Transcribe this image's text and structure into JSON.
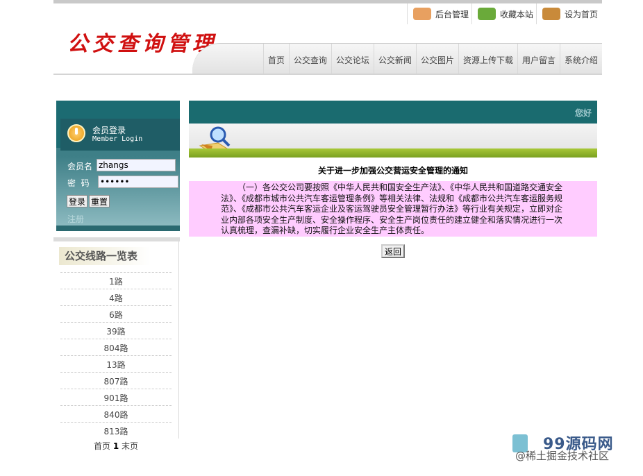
{
  "site": {
    "title": "公交查询管理"
  },
  "toplinks": [
    {
      "label": "后台管理",
      "icon": "admin-icon"
    },
    {
      "label": "收藏本站",
      "icon": "favorite-icon"
    },
    {
      "label": "设为首页",
      "icon": "home-icon"
    }
  ],
  "nav": [
    "首页",
    "公交查询",
    "公交论坛",
    "公交新闻",
    "公交图片",
    "资源上传下载",
    "用户留言",
    "系统介绍"
  ],
  "login": {
    "title": "会员登录",
    "subtitle": "Member Login",
    "username_label": "会员名",
    "username_value": "zhangs",
    "password_label": "密  码",
    "password_value": "123456",
    "login_btn": "登录",
    "reset_btn": "重置",
    "register_link": "注册"
  },
  "routes": {
    "title": "公交线路一览表",
    "items": [
      "1路",
      "4路",
      "6路",
      "39路",
      "804路",
      "13路",
      "807路",
      "901路",
      "840路",
      "813路"
    ],
    "pager": {
      "first": "首页",
      "current": "1",
      "last": "末页"
    }
  },
  "main": {
    "greeting": "您好",
    "notice_title": "关于进一步加强公交营运安全管理的通知",
    "notice_body": "（一）各公交公司要按照《中华人民共和国安全生产法》、《中华人民共和国道路交通安全法》、《成都市城市公共汽车客运管理条例》等相关法律、法规和《成都市公共汽车客运服务规范》、《成都市公共汽车客运企业及客运驾驶员安全管理暂行办法》等行业有关规定，立即对企业内部各项安全生产制度、安全操作程序、安全生产岗位责任的建立健全和落实情况进行一次认真梳理，查漏补缺，切实履行企业安全生产主体责任。",
    "back_btn": "返回"
  },
  "watermark": {
    "brand": "99源码网",
    "sub": "@稀土掘金技术社区"
  },
  "colors": {
    "title_red": "#d01010",
    "teal": "#1a6b6f",
    "green_bar": "#8ab028",
    "notice_bg": "#ffccff"
  }
}
